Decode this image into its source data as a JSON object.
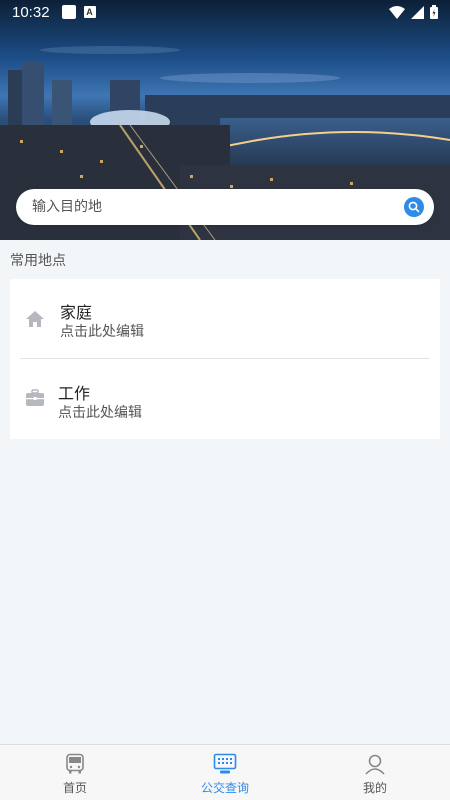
{
  "status_bar": {
    "time": "10:32",
    "icons": [
      "square-icon",
      "a-icon",
      "wifi-icon",
      "signal-icon",
      "battery-icon"
    ]
  },
  "hero": {
    "image": "city-night-skyline"
  },
  "search": {
    "placeholder": "输入目的地",
    "icon": "search-icon"
  },
  "favorites": {
    "section_title": "常用地点",
    "items": [
      {
        "name": "家庭",
        "subtitle": "点击此处编辑",
        "icon": "home-icon"
      },
      {
        "name": "工作",
        "subtitle": "点击此处编辑",
        "icon": "briefcase-icon"
      }
    ]
  },
  "bottom_nav": {
    "items": [
      {
        "label": "首页",
        "icon": "bus-icon",
        "active": false
      },
      {
        "label": "公交查询",
        "icon": "monitor-icon",
        "active": true
      },
      {
        "label": "我的",
        "icon": "user-icon",
        "active": false
      }
    ]
  },
  "colors": {
    "accent": "#2f8be8",
    "background": "#f3f6f8",
    "icon_gray": "#b5b9bf"
  }
}
